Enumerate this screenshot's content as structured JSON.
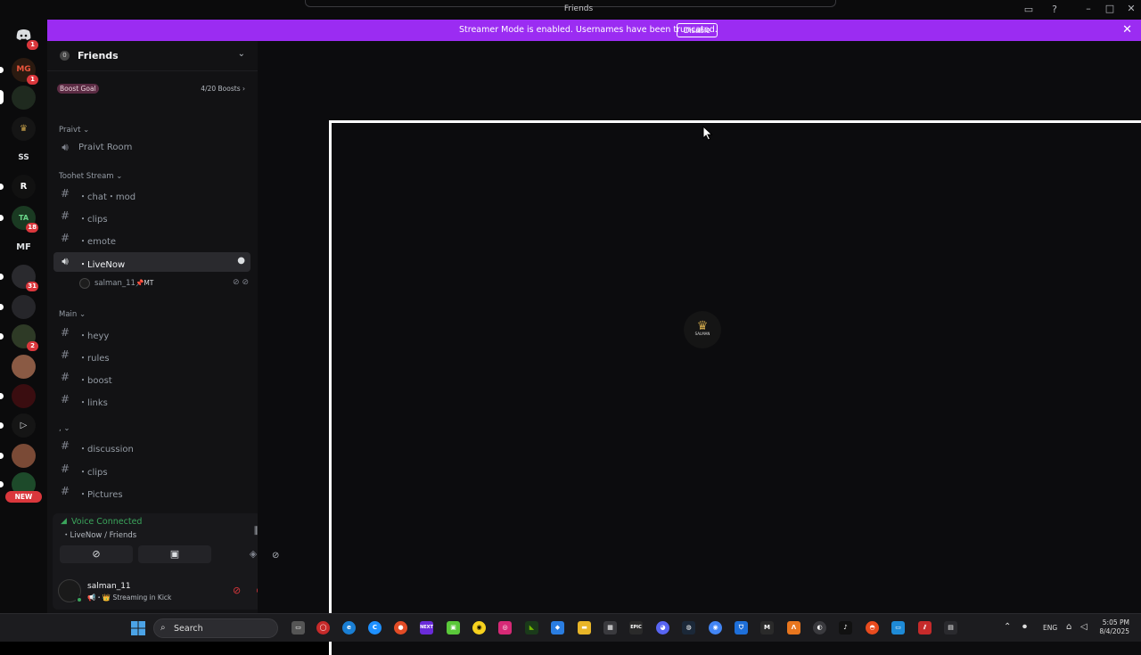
{
  "window": {
    "title": "Friends"
  },
  "banner": {
    "text": "Streamer Mode is enabled. Usernames have been truncated.",
    "button": "Disable",
    "close": "✕",
    "color": "#9b2cf2"
  },
  "guilds": {
    "items": [
      {
        "label": "",
        "icon": "discord-home-icon",
        "badge": "1"
      },
      {
        "label": "MG",
        "badge": "1"
      },
      {
        "label": "",
        "badge": ""
      },
      {
        "label": "♛",
        "badge": ""
      },
      {
        "label": "SS",
        "badge": ""
      },
      {
        "label": "R",
        "badge": ""
      },
      {
        "label": "TA",
        "badge": "18"
      },
      {
        "label": "MF",
        "badge": ""
      },
      {
        "label": "",
        "badge": "31"
      },
      {
        "label": "",
        "badge": ""
      },
      {
        "label": "",
        "badge": "2"
      },
      {
        "label": "",
        "badge": ""
      },
      {
        "label": "",
        "badge": ""
      },
      {
        "label": "▷",
        "badge": ""
      },
      {
        "label": "",
        "badge": ""
      },
      {
        "label": "",
        "badge": ""
      }
    ],
    "new_badge": "NEW"
  },
  "sidebar": {
    "title": "Friends",
    "boost": {
      "label": "Boost Goal",
      "count": "4/20 Boosts"
    },
    "categories": [
      {
        "name": "Praivt"
      },
      {
        "name": "Toohet Stream"
      },
      {
        "name": "Main"
      },
      {
        "name": ","
      }
    ],
    "channels": [
      {
        "name": "Praivt Room",
        "icon": "voice"
      },
      {
        "name": "・chat・mod",
        "icon": "text"
      },
      {
        "name": "・clips",
        "icon": "text"
      },
      {
        "name": "・emote",
        "icon": "text"
      },
      {
        "name": "・LiveNow",
        "icon": "voice",
        "selected": true
      },
      {
        "name": "・heyy",
        "icon": "text"
      },
      {
        "name": "・rules",
        "icon": "text"
      },
      {
        "name": "・boost",
        "icon": "text"
      },
      {
        "name": "・links",
        "icon": "text"
      },
      {
        "name": "・discussion",
        "icon": "text"
      },
      {
        "name": "・clips",
        "icon": "text"
      },
      {
        "name": "・Pictures",
        "icon": "text"
      }
    ],
    "voice_member": {
      "name": "salman_11",
      "tag": "📌MT"
    }
  },
  "voice_panel": {
    "status": "Voice Connected",
    "location": "・LiveNow / Friends"
  },
  "user": {
    "name": "salman_11",
    "status": "📢・👑 Streaming in Kick"
  },
  "stream": {
    "logo_text": "SALMAN"
  },
  "taskbar": {
    "search": "Search",
    "apps": [
      "NEXT",
      "EPIC",
      "M"
    ],
    "lang": "ENG",
    "time": "5:05 PM",
    "date": "8/4/2025"
  }
}
